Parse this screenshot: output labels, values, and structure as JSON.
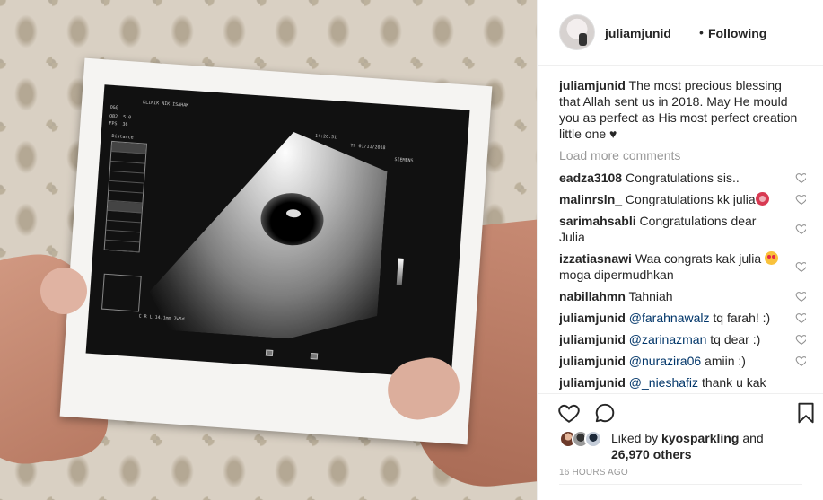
{
  "post": {
    "username": "juliamjunid",
    "separator": "•",
    "follow_status": "Following"
  },
  "caption": {
    "username": "juliamjunid",
    "text": "The most precious blessing that Allah sent us in 2018. May He mould you as perfect as His most perfect creation little one ♥"
  },
  "load_more_label": "Load more comments",
  "comments": [
    {
      "user": "eadza3108",
      "text": "Congratulations sis..",
      "mention": "",
      "emoji": ""
    },
    {
      "user": "malinrsln_",
      "text": "Congratulations kk julia",
      "mention": "",
      "emoji": "hearts"
    },
    {
      "user": "sarimahsabli",
      "text": "Congratulations dear Julia",
      "mention": "",
      "emoji": ""
    },
    {
      "user": "izzatiasnawi",
      "text": "Waa congrats kak julia",
      "mention": "",
      "emoji": "love",
      "text_after": "moga dipermudhkan"
    },
    {
      "user": "nabillahmn",
      "text": "Tahniah",
      "mention": "",
      "emoji": ""
    },
    {
      "user": "juliamjunid",
      "mention": "@farahnawalz",
      "text": "tq farah! :)",
      "emoji": ""
    },
    {
      "user": "juliamjunid",
      "mention": "@zarinazman",
      "text": "tq dear :)",
      "emoji": ""
    },
    {
      "user": "juliamjunid",
      "mention": "@nurazira06",
      "text": "amiin :)",
      "emoji": ""
    },
    {
      "user": "juliamjunid",
      "mention": "@_nieshafiz",
      "text": "thank u kak",
      "emoji": ""
    }
  ],
  "likes": {
    "prefix": "Liked by",
    "user": "kyosparkling",
    "middle": "and",
    "count": "26,970 others"
  },
  "timestamp": "16 HOURS AGO",
  "icons": {
    "like": "heart-icon",
    "comment": "comment-bubble-icon",
    "save": "bookmark-icon",
    "comment_like": "small-heart-icon"
  },
  "scan_text": {
    "clinic": "KLINIK NIK ISAHAK",
    "time": "14:26:51",
    "date": "Th 01/11/2018",
    "brand": "SIEMENS",
    "crl": "C R L   14.1mm 7w5d",
    "distance": "Distance"
  },
  "colors": {
    "text": "#262626",
    "muted": "#999999",
    "mention": "#003569",
    "border": "#efefef"
  }
}
